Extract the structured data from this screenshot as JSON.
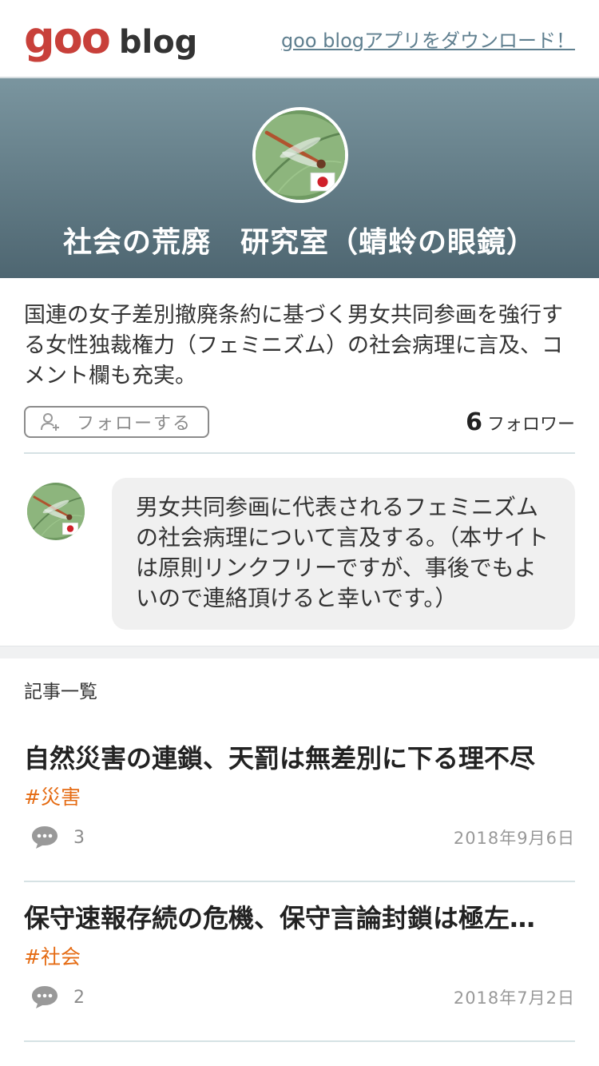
{
  "header": {
    "logo_goo": "goo",
    "logo_blog": "blog",
    "app_link": "goo blogアプリをダウンロード！"
  },
  "hero": {
    "title": "社会の荒廃　研究室（蜻蛉の眼鏡）"
  },
  "profile": {
    "description": "国連の女子差別撤廃条約に基づく男女共同参画を強行する女性独裁権力（フェミニズム）の社会病理に言及、コメント欄も充実。",
    "follow_button": "フォローする",
    "follower_count": "6",
    "follower_label": "フォロワー"
  },
  "bio": {
    "text": "男女共同参画に代表されるフェミニズムの社会病理について言及する。（本サイトは原則リンクフリーですが、事後でもよいので連絡頂けると幸いです。）"
  },
  "articles_section": {
    "heading": "記事一覧",
    "items": [
      {
        "title": "自然災害の連鎖、天罰は無差別に下る理不尽",
        "tag": "#災害",
        "comments": "3",
        "date": "2018年9月6日"
      },
      {
        "title": "保守速報存続の危機、保守言論封鎖は極左…",
        "tag": "#社会",
        "comments": "2",
        "date": "2018年7月2日"
      }
    ]
  },
  "colors": {
    "brand_red": "#c8403a",
    "tag_orange": "#e56c14",
    "hero_top": "#7a959f",
    "hero_bottom": "#4e6671"
  },
  "icons": {
    "follow": "add-user-icon",
    "comment": "speech-bubble-icon",
    "flag": "japan-flag-icon"
  }
}
